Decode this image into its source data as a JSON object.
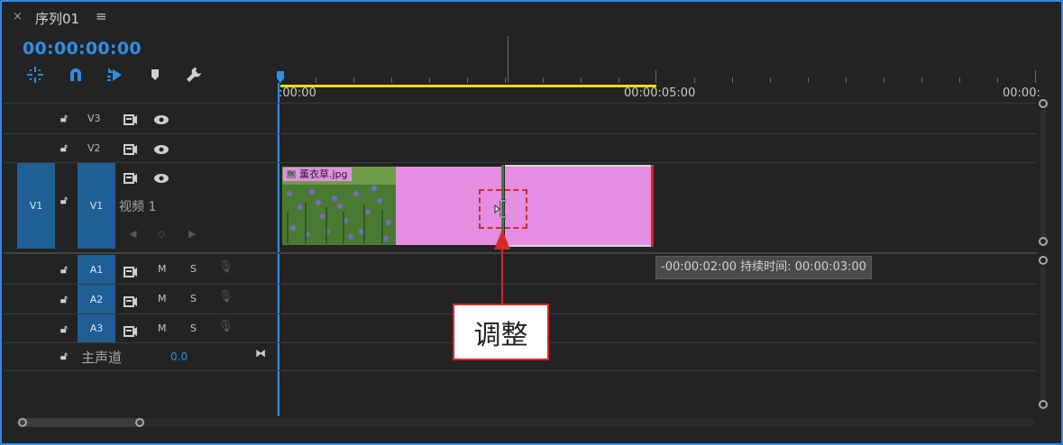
{
  "panel": {
    "close_symbol": "×",
    "title": "序列01",
    "menu_symbol": "≡"
  },
  "timecode": "00:00:00:00",
  "toolbar": {
    "icons": [
      "snap-insert-icon",
      "magnet-icon",
      "linked-selection-icon",
      "marker-icon",
      "wrench-icon"
    ]
  },
  "ruler": {
    "labels": [
      ":00:00",
      "00:00:05:00",
      "00:00:"
    ]
  },
  "tracks": {
    "v3": {
      "label": "V3"
    },
    "v2": {
      "label": "V2"
    },
    "v1": {
      "source": "V1",
      "label": "V1",
      "name": "视频 1"
    },
    "a1": {
      "label": "A1",
      "m": "M",
      "s": "S"
    },
    "a2": {
      "label": "A2",
      "m": "M",
      "s": "S"
    },
    "a3": {
      "label": "A3",
      "m": "M",
      "s": "S"
    },
    "master": {
      "name": "主声道",
      "value": "0.0"
    }
  },
  "clip": {
    "name": "薰衣草.jpg",
    "color": "#e38ee3"
  },
  "tooltip": "-00:00:02:00 持续时间: 00:00:03:00",
  "callout": "调整",
  "colors": {
    "accent": "#2e8fe8",
    "highlight": "#d42a2a",
    "workarea": "#e5dd1e"
  }
}
